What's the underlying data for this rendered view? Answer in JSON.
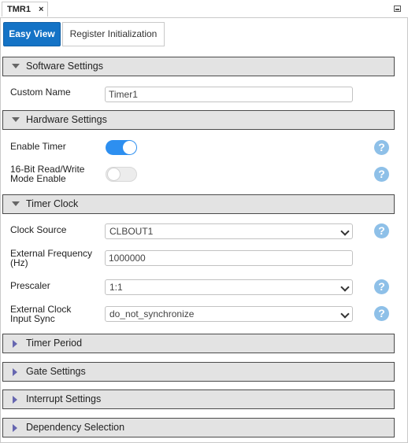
{
  "window": {
    "tab_title": "TMR1",
    "tab_close": "×"
  },
  "view_tabs": [
    {
      "label": "Easy View",
      "active": true
    },
    {
      "label": "Register Initialization",
      "active": false
    }
  ],
  "sections": {
    "software": {
      "title": "Software Settings",
      "expanded": true,
      "custom_name": {
        "label": "Custom Name",
        "value": "Timer1"
      }
    },
    "hardware": {
      "title": "Hardware Settings",
      "expanded": true,
      "enable_timer": {
        "label": "Enable Timer",
        "on": true
      },
      "rw16": {
        "label_line1": "16-Bit Read/Write",
        "label_line2": "Mode Enable",
        "on": false
      }
    },
    "clock": {
      "title": "Timer Clock",
      "expanded": true,
      "clock_source": {
        "label": "Clock Source",
        "value": "CLBOUT1"
      },
      "ext_freq": {
        "label_line1": "External Frequency",
        "label_line2": "(Hz)",
        "value": "1000000"
      },
      "prescaler": {
        "label": "Prescaler",
        "value": "1:1"
      },
      "ext_sync": {
        "label_line1": "External Clock",
        "label_line2": "Input Sync",
        "value": "do_not_synchronize"
      }
    },
    "period": {
      "title": "Timer Period",
      "expanded": false
    },
    "gate": {
      "title": "Gate Settings",
      "expanded": false
    },
    "interrupt": {
      "title": "Interrupt Settings",
      "expanded": false
    },
    "dependency": {
      "title": "Dependency Selection",
      "expanded": false
    }
  },
  "help_glyph": "?",
  "colors": {
    "accent": "#1473c6",
    "toggle_on": "#2d8ff0",
    "help_icon": "#8ec0e8",
    "section_bg": "#e3e3e3"
  }
}
